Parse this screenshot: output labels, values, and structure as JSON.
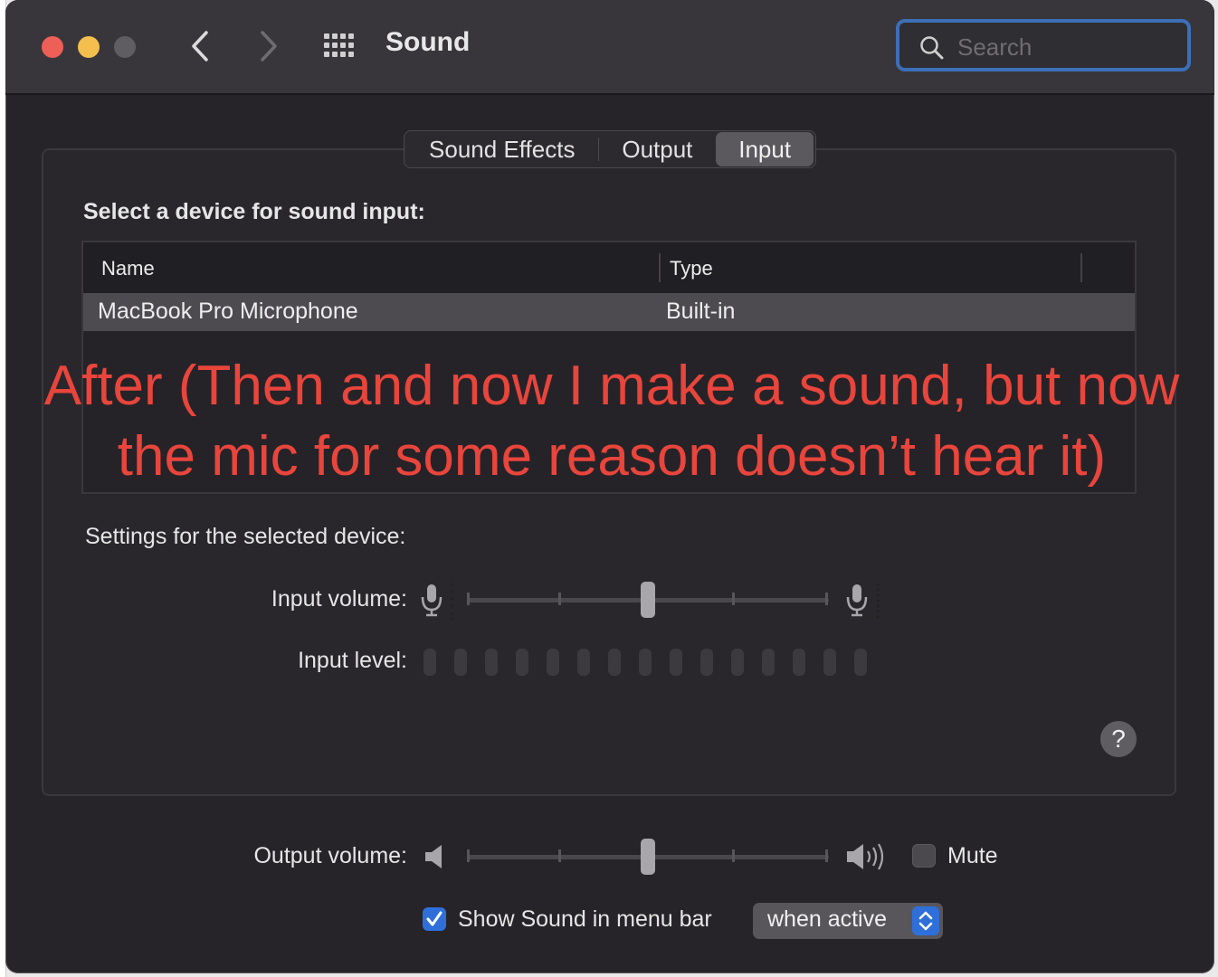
{
  "window": {
    "title": "Sound",
    "search_placeholder": "Search"
  },
  "tabs": [
    {
      "label": "Sound Effects",
      "selected": false
    },
    {
      "label": "Output",
      "selected": false
    },
    {
      "label": "Input",
      "selected": true
    }
  ],
  "input": {
    "select_label": "Select a device for sound input:",
    "columns": [
      "Name",
      "Type"
    ],
    "devices": [
      {
        "name": "MacBook Pro Microphone",
        "type": "Built-in",
        "selected": true
      }
    ],
    "settings_label": "Settings for the selected device:",
    "input_volume_label": "Input volume:",
    "input_volume_level": 0.5,
    "input_level_label": "Input level:",
    "input_level_segments": 15,
    "input_level_active": 0
  },
  "annotation": {
    "line1": "After (Then and now I make a sound, but now",
    "line2": "the mic for some reason doesn’t hear it)"
  },
  "bottom": {
    "output_volume_label": "Output volume:",
    "output_volume_level": 0.5,
    "mute_label": "Mute",
    "mute_checked": false,
    "show_in_menu_bar_label": "Show Sound in menu bar",
    "show_in_menu_bar_checked": true,
    "menu_bar_option": "when active"
  },
  "colors": {
    "accent": "#2f6fd9",
    "annotation": "#e8453c",
    "window_bg": "#262429"
  },
  "icons": [
    "close-button",
    "minimize-button",
    "zoom-button",
    "chevron-left-icon",
    "chevron-right-icon",
    "grid-icon",
    "search-icon",
    "microphone-icon",
    "speaker-icon",
    "speaker-loud-icon",
    "checkmark-icon",
    "up-down-chevron-icon",
    "question-mark-icon"
  ]
}
